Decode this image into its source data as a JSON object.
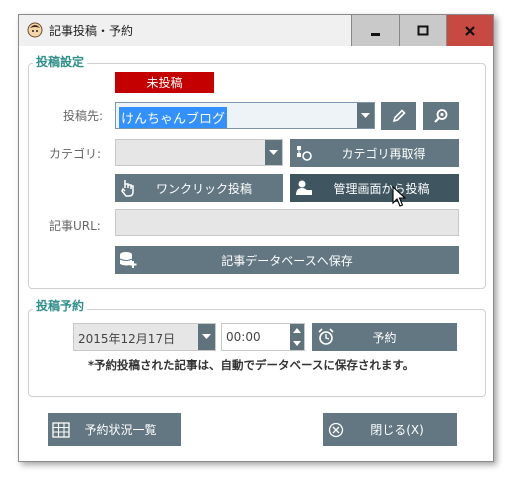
{
  "window": {
    "title": "記事投稿・予約"
  },
  "post_settings": {
    "group_title": "投稿設定",
    "status_badge": "未投稿",
    "target_label": "投稿先:",
    "target_value": "けんちゃんブログ",
    "category_label": "カテゴリ:",
    "category_value": "",
    "refetch_category_label": "カテゴリ再取得",
    "one_click_post_label": "ワンクリック投稿",
    "admin_post_label": "管理画面から投稿",
    "article_url_label": "記事URL:",
    "article_url_value": "",
    "save_db_label": "記事データベースへ保存"
  },
  "schedule": {
    "group_title": "投稿予約",
    "date_value": "2015年12月17日",
    "time_value": "00:00",
    "reserve_label": "予約",
    "note": "*予約投稿された記事は、自動でデータベースに保存されます。"
  },
  "footer": {
    "schedule_list_label": "予約状況一覧",
    "close_label": "閉じる(X)"
  },
  "colors": {
    "button": "#627782",
    "button_active": "#3f5560",
    "badge": "#c40000",
    "group_title": "#2f8f8a",
    "close_button": "#c74a42",
    "selection": "#3390ff"
  },
  "icons": [
    "app-icon",
    "minimize-icon",
    "maximize-icon",
    "close-icon",
    "pencil-icon",
    "search-icon",
    "refresh-category-icon",
    "hand-pointer-icon",
    "user-admin-icon",
    "database-add-icon",
    "alarm-clock-icon",
    "grid-table-icon",
    "circle-x-icon",
    "mouse-cursor-icon"
  ]
}
